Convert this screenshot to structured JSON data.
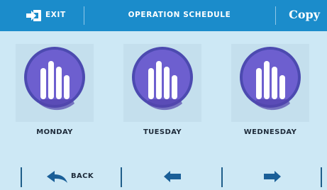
{
  "header": {
    "exit_label": "EXIT",
    "title": "OPERATION SCHEDULE",
    "copy_label": "Copy"
  },
  "days": [
    {
      "label": "MONDAY",
      "icon": "schedule-bars-icon"
    },
    {
      "label": "TUESDAY",
      "icon": "schedule-bars-icon"
    },
    {
      "label": "WEDNESDAY",
      "icon": "schedule-bars-icon"
    }
  ],
  "footer": {
    "back_label": "BACK",
    "back_icon": "back-arrow-icon",
    "prev_icon": "arrow-left-icon",
    "next_icon": "arrow-right-icon"
  },
  "colors": {
    "header_bg": "#1b8ccb",
    "screen_bg": "#cde8f5",
    "circle_fill": "#6d5fcf",
    "circle_border": "#4c4ab0",
    "bars": "#ffffff",
    "dark_blue": "#1a5f98"
  }
}
